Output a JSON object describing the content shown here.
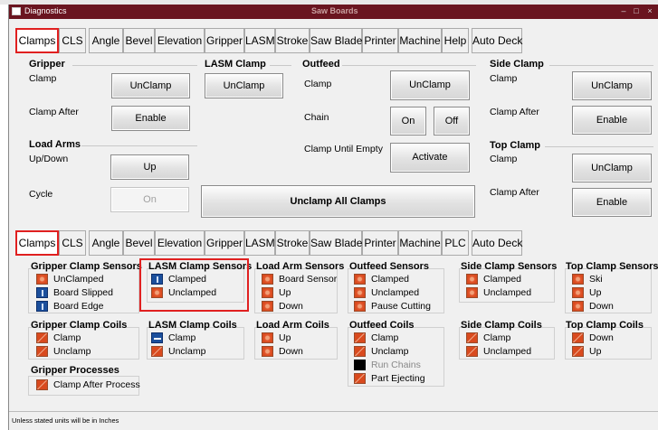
{
  "window": {
    "title": "Diagnostics",
    "center_title": "Saw Boards"
  },
  "tabs_top": [
    "Clamps",
    "CLS",
    "Angle",
    "Bevel",
    "Elevation",
    "Gripper",
    "LASM",
    "Stroke",
    "Saw Blade",
    "Printer",
    "Machine",
    "Help",
    "Auto Deck"
  ],
  "tabs_bottom": [
    "Clamps",
    "CLS",
    "Angle",
    "Bevel",
    "Elevation",
    "Gripper",
    "LASM",
    "Stroke",
    "Saw Blade",
    "Printer",
    "Machine",
    "PLC",
    "Auto Deck"
  ],
  "top": {
    "gripper": {
      "title": "Gripper",
      "clamp_label": "Clamp",
      "clamp_btn": "UnClamp",
      "clamp_after_label": "Clamp After",
      "clamp_after_btn": "Enable"
    },
    "load_arms": {
      "title": "Load Arms",
      "updown_label": "Up/Down",
      "updown_btn": "Up",
      "cycle_label": "Cycle",
      "cycle_btn": "On"
    },
    "lasm_clamp": {
      "title": "LASM Clamp",
      "btn": "UnClamp"
    },
    "outfeed": {
      "title": "Outfeed",
      "clamp_label": "Clamp",
      "clamp_btn": "UnClamp",
      "chain_label": "Chain",
      "chain_on": "On",
      "chain_off": "Off",
      "until_empty_label": "Clamp Until Empty",
      "until_empty_btn": "Activate"
    },
    "unclamp_all": "Unclamp All Clamps",
    "side_clamp": {
      "title": "Side Clamp",
      "clamp_label": "Clamp",
      "clamp_btn": "UnClamp",
      "clamp_after_label": "Clamp After",
      "clamp_after_btn": "Enable"
    },
    "top_clamp": {
      "title": "Top Clamp",
      "clamp_label": "Clamp",
      "clamp_btn": "UnClamp",
      "clamp_after_label": "Clamp After",
      "clamp_after_btn": "Enable"
    }
  },
  "sensors": {
    "gripper_clamp": {
      "title": "Gripper Clamp Sensors",
      "items": [
        "UnClamped",
        "Board Slipped",
        "Board Edge"
      ]
    },
    "lasm_clamp": {
      "title": "LASM Clamp Sensors",
      "items": [
        "Clamped",
        "Unclamped"
      ]
    },
    "load_arm": {
      "title": "Load Arm Sensors",
      "items": [
        "Board Sensor",
        "Up",
        "Down"
      ]
    },
    "outfeed": {
      "title": "Outfeed Sensors",
      "items": [
        "Clamped",
        "Unclamped",
        "Pause Cutting"
      ]
    },
    "side_clamp": {
      "title": "Side Clamp Sensors",
      "items": [
        "Clamped",
        "Unclamped"
      ]
    },
    "top_clamp": {
      "title": "Top Clamp Sensors",
      "items": [
        "Ski",
        "Up",
        "Down"
      ]
    }
  },
  "coils": {
    "gripper_clamp": {
      "title": "Gripper Clamp Coils",
      "items": [
        "Clamp",
        "Unclamp"
      ]
    },
    "lasm_clamp": {
      "title": "LASM Clamp Coils",
      "items": [
        "Clamp",
        "Unclamp"
      ]
    },
    "load_arm": {
      "title": "Load Arm Coils",
      "items": [
        "Up",
        "Down"
      ]
    },
    "outfeed": {
      "title": "Outfeed Coils",
      "items": [
        "Clamp",
        "Unclamp",
        "Run Chains",
        "Part Ejecting"
      ]
    },
    "side_clamp": {
      "title": "Side Clamp Coils",
      "items": [
        "Clamp",
        "Unclamped"
      ]
    },
    "top_clamp": {
      "title": "Top Clamp Coils",
      "items": [
        "Down",
        "Up"
      ]
    }
  },
  "gripper_processes": {
    "title": "Gripper Processes",
    "items": [
      "Clamp After Process"
    ]
  },
  "status_bar": "Unless stated units will be in Inches",
  "colors": {
    "titlebar": "#6a1520",
    "highlight": "#e02020",
    "indicator_orange": "#e0542a",
    "indicator_blue": "#1b4f9c"
  }
}
